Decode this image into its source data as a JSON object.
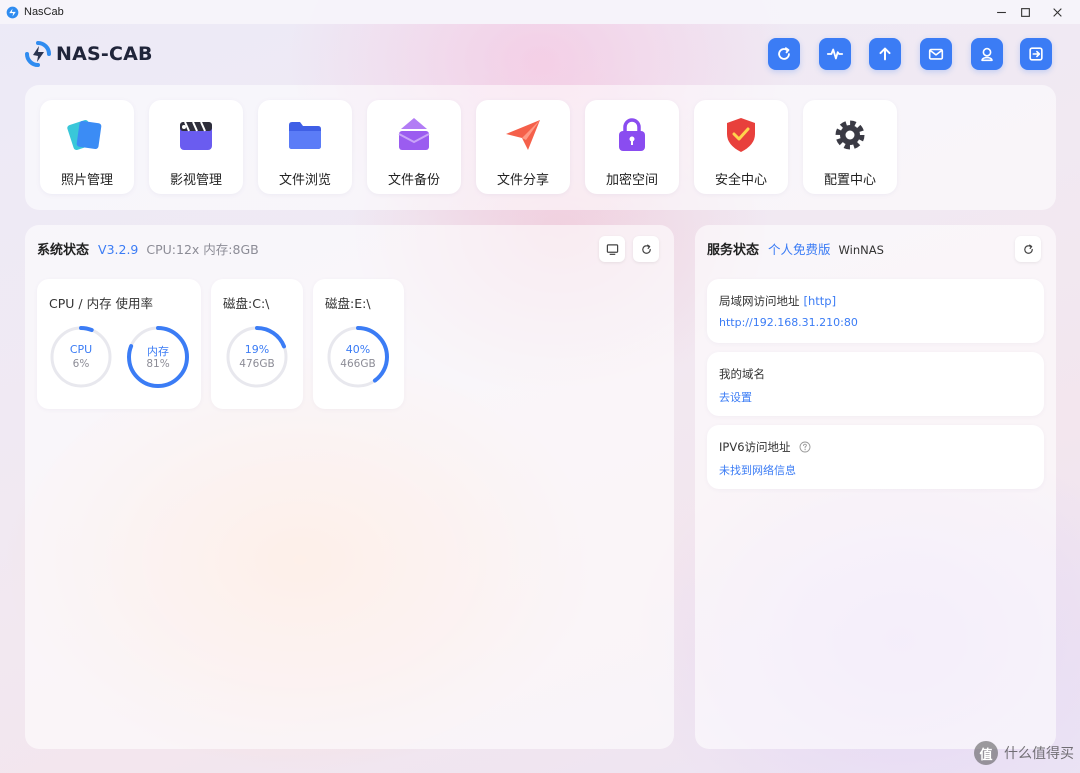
{
  "window": {
    "title": "NasCab"
  },
  "header": {
    "logo_text": "NAS-CAB",
    "buttons": [
      "refresh-icon",
      "activity-icon",
      "upload-icon",
      "mail-icon",
      "user-icon",
      "logout-icon"
    ]
  },
  "apps": [
    {
      "label": "照片管理",
      "icon": "photos-icon",
      "color": "#3b8cf5"
    },
    {
      "label": "影视管理",
      "icon": "movie-icon",
      "color": "#6a5cf0"
    },
    {
      "label": "文件浏览",
      "icon": "folder-icon",
      "color": "#4f6df5"
    },
    {
      "label": "文件备份",
      "icon": "backup-icon",
      "color": "#9b5cf0"
    },
    {
      "label": "文件分享",
      "icon": "share-icon",
      "color": "#f5604a"
    },
    {
      "label": "加密空间",
      "icon": "lock-icon",
      "color": "#8a4cf0"
    },
    {
      "label": "安全中心",
      "icon": "shield-icon",
      "color": "#e8403c"
    },
    {
      "label": "配置中心",
      "icon": "gear-icon",
      "color": "#3a3a44"
    }
  ],
  "system": {
    "title": "系统状态",
    "version": "V3.2.9",
    "meta": "CPU:12x 内存:8GB",
    "cards": [
      {
        "title": "CPU / 内存 使用率",
        "rings": [
          {
            "label": "CPU",
            "value": "6%",
            "percent": 6
          },
          {
            "label": "内存",
            "value": "81%",
            "percent": 81
          }
        ]
      },
      {
        "title": "磁盘:C:\\",
        "rings": [
          {
            "label": "19%",
            "value": "476GB",
            "percent": 19
          }
        ]
      },
      {
        "title": "磁盘:E:\\",
        "rings": [
          {
            "label": "40%",
            "value": "466GB",
            "percent": 40
          }
        ]
      }
    ]
  },
  "service": {
    "title": "服务状态",
    "edition": "个人免费版",
    "product": "WinNAS",
    "items": [
      {
        "label": "局域网访问地址",
        "tag": "[http]",
        "value": "http://192.168.31.210:80"
      },
      {
        "label": "我的域名",
        "tag": "",
        "value": "去设置"
      },
      {
        "label": "IPV6访问地址",
        "tag": "",
        "value": "未找到网络信息"
      }
    ]
  },
  "watermark": {
    "badge": "值",
    "text": "什么值得买"
  },
  "colors": {
    "accent": "#3b7cf5",
    "ring_track": "#e8e8ee"
  }
}
